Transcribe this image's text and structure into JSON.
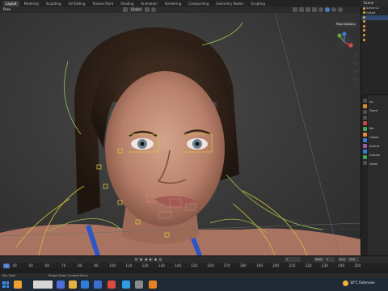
{
  "workspace_tabs": [
    {
      "label": "Layout",
      "active": true
    },
    {
      "label": "Modeling",
      "active": false
    },
    {
      "label": "Sculpting",
      "active": false
    },
    {
      "label": "UV Editing",
      "active": false
    },
    {
      "label": "Texture Paint",
      "active": false
    },
    {
      "label": "Shading",
      "active": false
    },
    {
      "label": "Animation",
      "active": false
    },
    {
      "label": "Rendering",
      "active": false
    },
    {
      "label": "Compositing",
      "active": false
    },
    {
      "label": "Geometry Nodes",
      "active": false
    },
    {
      "label": "Scripting",
      "active": false
    }
  ],
  "scene": {
    "label": "Scene"
  },
  "viewport": {
    "mode": "Pose",
    "orientation": "Global",
    "overlay_button": "Pose Options"
  },
  "outliner": {
    "rows": [
      "Scene Co",
      "Collect",
      "",
      "",
      "",
      "",
      "",
      ""
    ]
  },
  "properties": {
    "rows": [
      "rig",
      "Transf",
      "",
      "Rel",
      "Collect",
      "Inverse",
      "Custom",
      "Viewp"
    ]
  },
  "timeline": {
    "current_frame": "1",
    "start_label": "Start",
    "start_value": "1",
    "end_label": "End",
    "end_value": "250",
    "ruler_ticks": [
      "0",
      "40",
      "50",
      "60",
      "70",
      "80",
      "90",
      "100",
      "110",
      "120",
      "130",
      "140",
      "150",
      "160",
      "170",
      "180",
      "190",
      "200",
      "210",
      "220",
      "230",
      "240",
      "250"
    ]
  },
  "statusbar": {
    "left": "Pan View",
    "middle": "Shape Sheet Context Menu"
  },
  "taskbar": {
    "weather": "30°C Extensive"
  },
  "colors": {
    "accent": "#4a7bc4",
    "bone_yellow": "#d8c23c",
    "bone_green": "#9ac14a"
  }
}
